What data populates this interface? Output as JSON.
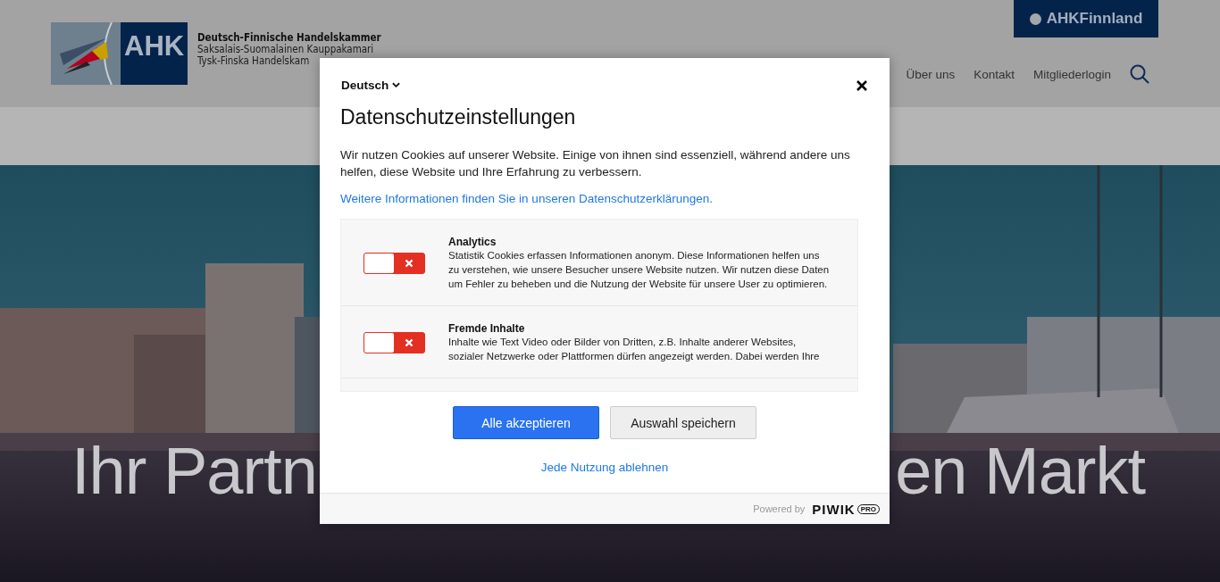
{
  "header": {
    "logo_text": "AHK",
    "org_names": [
      "Deutsch-Finnische Handelskammer",
      "Saksalais-Suomalainen Kauppakamari",
      "Tysk-Finska Handelskam"
    ],
    "top_link": "AHKFinnland",
    "nav": [
      "Über uns",
      "Kontakt",
      "Mitgliederlogin"
    ]
  },
  "hero": {
    "kind": "picture",
    "headline_left": "Ihr Partn",
    "headline_right": "en Markt"
  },
  "dialog": {
    "language": "Deutsch",
    "title": "Datenschutzeinstellungen",
    "intro": "Wir nutzen Cookies auf unserer Website. Einige von ihnen sind essenziell, während andere uns helfen, diese Website und Ihre Erfahrung zu verbessern.",
    "info_link": "Weitere Informationen finden Sie in unseren Datenschutzerklärungen.",
    "categories": [
      {
        "title": "Analytics",
        "description": "Statistik Cookies erfassen Informationen anonym. Diese Informationen helfen uns zu verstehen, wie unsere Besucher unsere Website nutzen. Wir nutzen diese Daten um Fehler zu beheben und die Nutzung der Website für unsere User zu optimieren.",
        "on": false
      },
      {
        "title": "Fremde Inhalte",
        "description": "Inhalte wie Text Video oder Bilder von Dritten, z.B. Inhalte anderer Websites, sozialer Netzwerke oder Plattformen dürfen angezeigt werden. Dabei werden Ihre",
        "on": false
      }
    ],
    "buttons": [
      {
        "label": "Alle akzeptieren",
        "kind": "primary"
      },
      {
        "label": "Auswahl speichern",
        "kind": "secondary"
      }
    ],
    "reject_link": "Jede Nutzung ablehnen",
    "powered_by": "Powered by",
    "brand": "PIWIK",
    "brand_badge": "PRO"
  }
}
